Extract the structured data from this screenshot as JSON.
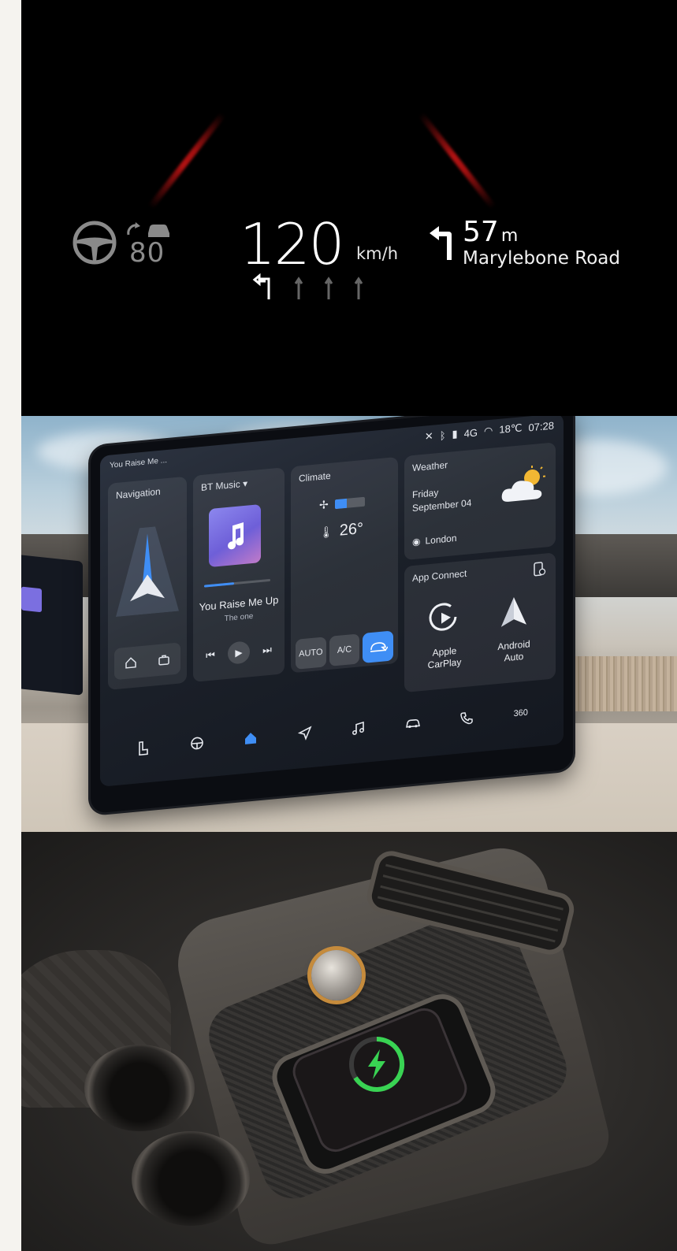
{
  "hud": {
    "speed_limit": "80",
    "speed": "120",
    "speed_unit": "km/h",
    "distance_value": "57",
    "distance_unit": "m",
    "road_name": "Marylebone Road",
    "icons": [
      "steering-wheel-icon",
      "adaptive-cruise-icon",
      "turn-left-icon",
      "lane-arrows-icon"
    ]
  },
  "infotainment": {
    "status": {
      "now_playing": "You Raise Me ...",
      "network": "4G",
      "temperature": "18℃",
      "time": "07:28"
    },
    "navigation": {
      "title": "Navigation"
    },
    "music": {
      "source": "BT Music",
      "track": "You Raise Me Up",
      "artist": "The one",
      "progress": 0.45
    },
    "climate": {
      "title": "Climate",
      "temperature": "26°",
      "fan_level": 0.4,
      "buttons": [
        "AUTO",
        "A/C"
      ]
    },
    "weather": {
      "title": "Weather",
      "day": "Friday",
      "date": "September 04",
      "city": "London"
    },
    "app_connect": {
      "title": "App Connect",
      "apps": [
        "Apple CarPlay",
        "Android Auto"
      ],
      "apple_line1": "Apple",
      "apple_line2": "CarPlay",
      "android_line1": "Android",
      "android_line2": "Auto"
    },
    "dock": {
      "items": [
        "seat-icon",
        "steering-heat-icon",
        "home-icon",
        "navigation-icon",
        "music-icon",
        "car-icon",
        "phone-icon",
        "360-view-icon"
      ],
      "label_360": "360"
    }
  },
  "colors": {
    "accent": "#3f8ef5",
    "hud_red": "#b01212",
    "charge_green": "#39d353"
  }
}
